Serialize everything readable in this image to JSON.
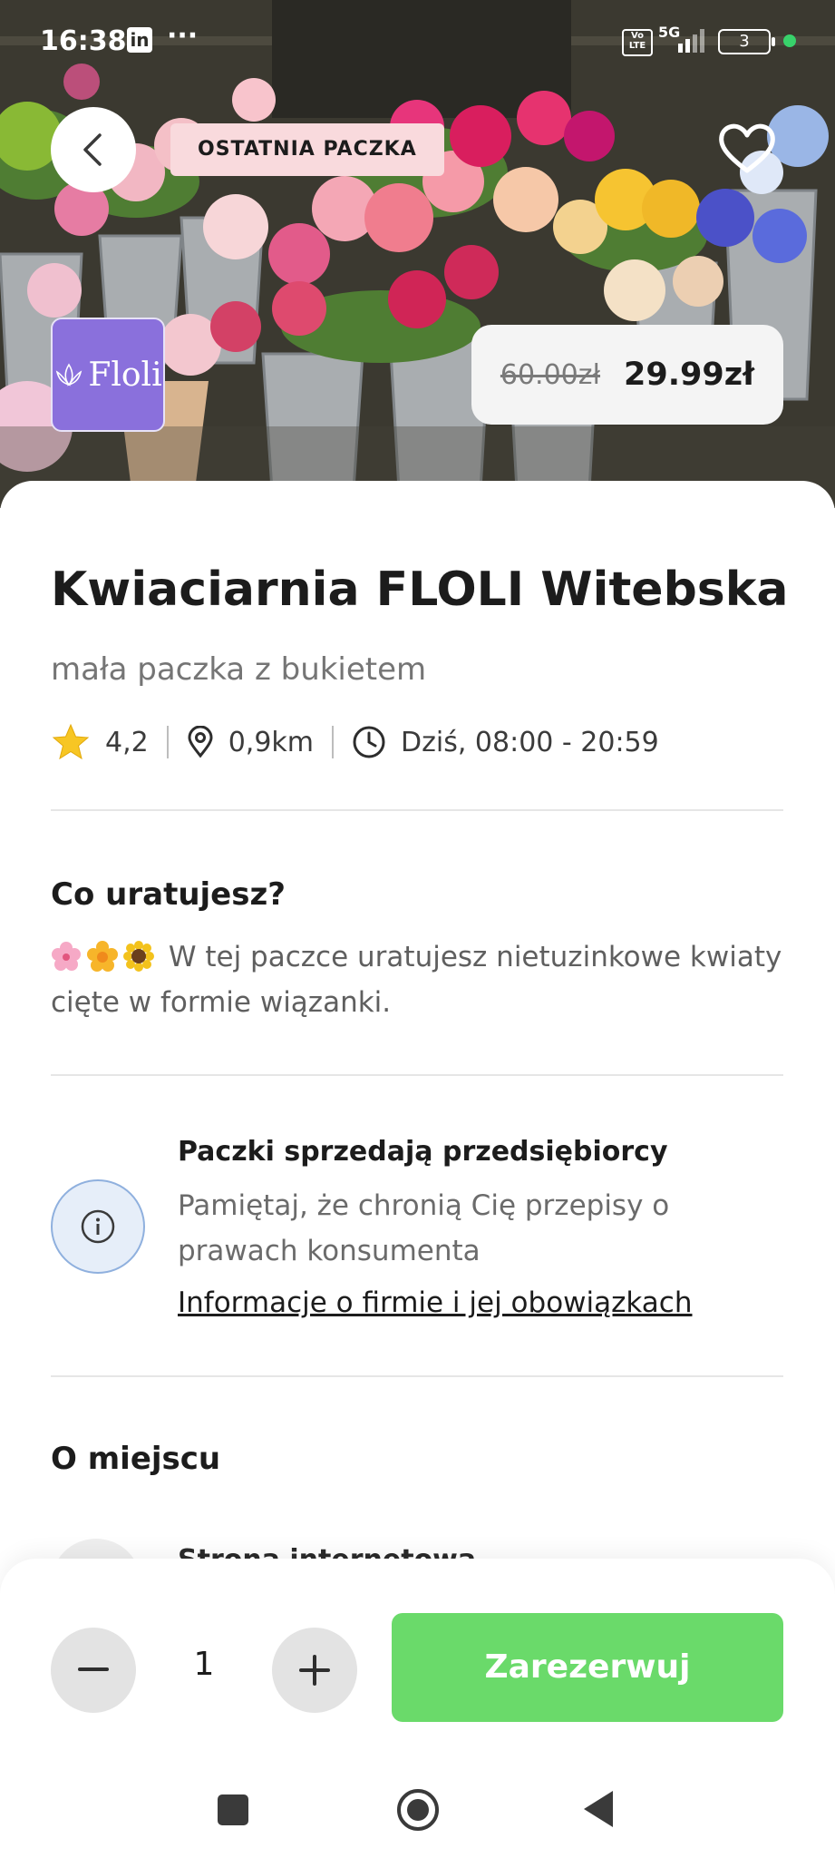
{
  "status_bar": {
    "time": "16:38",
    "app_badge": "in",
    "more": "···",
    "volte": "Vo LTE",
    "network": "5G",
    "battery": "3",
    "colors": {
      "dot": "#38d26b"
    }
  },
  "hero": {
    "badge": "OSTATNIA PACZKA",
    "logo_text": "Floli",
    "price_old": "60.00zł",
    "price_new": "29.99zł",
    "icons": {
      "back": "chevron-left-icon",
      "favorite": "heart-icon"
    }
  },
  "store": {
    "title": "Kwiaciarnia FLOLI Witebska",
    "subtitle": "mała paczka z bukietem",
    "rating": "4,2",
    "distance": "0,9km",
    "hours": "Dziś, 08:00 - 20:59"
  },
  "rescue": {
    "heading": "Co uratujesz?",
    "description": "W tej paczce uratujesz nietuzinkowe kwiaty cięte w formie wiązanki."
  },
  "info": {
    "title": "Paczki sprzedają przedsiębiorcy",
    "text": "Pamiętaj, że chronią Cię przepisy o prawach konsumenta",
    "link": "Informacje o firmie i jej obowiązkach"
  },
  "place": {
    "heading": "O miejscu",
    "peek_item": "Strona internetowa"
  },
  "bottom_bar": {
    "quantity": "1",
    "reserve_label": "Zarezerwuj",
    "colors": {
      "reserve": "#6ada6a"
    }
  }
}
